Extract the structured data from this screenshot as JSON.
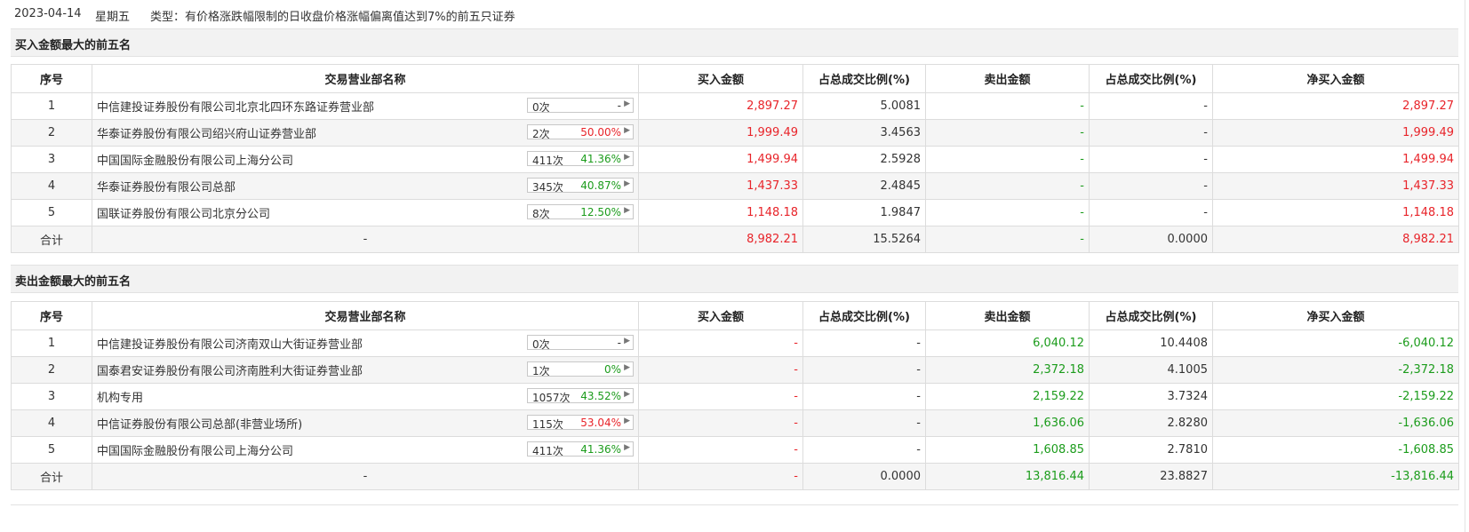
{
  "header": {
    "date": "2023-04-14",
    "weekday": "星期五",
    "type_text": "类型：有价格涨跌幅限制的日收盘价格涨幅偏离值达到7%的前五只证券"
  },
  "colors": {
    "up": "#e8242a",
    "down": "#1c9c1c"
  },
  "columns": {
    "idx": "序号",
    "name": "交易营业部名称",
    "buy": "买入金额",
    "buy_pct": "占总成交比例(%)",
    "sell": "卖出金额",
    "sell_pct": "占总成交比例(%)",
    "net": "净买入金额"
  },
  "buy_table": {
    "title": "买入金额最大的前五名",
    "rows": [
      {
        "idx": "1",
        "name": "中信建投证券股份有限公司北京北四环东路证券营业部",
        "count": "0次",
        "rate": "-",
        "rate_color": "neutral",
        "buy": "2,897.27",
        "buy_pct": "5.0081",
        "sell": "-",
        "sell_pct": "-",
        "net": "2,897.27"
      },
      {
        "idx": "2",
        "name": "华泰证券股份有限公司绍兴府山证券营业部",
        "count": "2次",
        "rate": "50.00%",
        "rate_color": "red",
        "buy": "1,999.49",
        "buy_pct": "3.4563",
        "sell": "-",
        "sell_pct": "-",
        "net": "1,999.49"
      },
      {
        "idx": "3",
        "name": "中国国际金融股份有限公司上海分公司",
        "count": "411次",
        "rate": "41.36%",
        "rate_color": "green",
        "buy": "1,499.94",
        "buy_pct": "2.5928",
        "sell": "-",
        "sell_pct": "-",
        "net": "1,499.94"
      },
      {
        "idx": "4",
        "name": "华泰证券股份有限公司总部",
        "count": "345次",
        "rate": "40.87%",
        "rate_color": "green",
        "buy": "1,437.33",
        "buy_pct": "2.4845",
        "sell": "-",
        "sell_pct": "-",
        "net": "1,437.33"
      },
      {
        "idx": "5",
        "name": "国联证券股份有限公司北京分公司",
        "count": "8次",
        "rate": "12.50%",
        "rate_color": "green",
        "buy": "1,148.18",
        "buy_pct": "1.9847",
        "sell": "-",
        "sell_pct": "-",
        "net": "1,148.18"
      }
    ],
    "total": {
      "label": "合计",
      "name": "-",
      "buy": "8,982.21",
      "buy_pct": "15.5264",
      "sell": "-",
      "sell_pct": "0.0000",
      "net": "8,982.21"
    }
  },
  "sell_table": {
    "title": "卖出金额最大的前五名",
    "rows": [
      {
        "idx": "1",
        "name": "中信建投证券股份有限公司济南双山大街证券营业部",
        "count": "0次",
        "rate": "-",
        "rate_color": "neutral",
        "buy": "-",
        "buy_pct": "-",
        "sell": "6,040.12",
        "sell_pct": "10.4408",
        "net": "-6,040.12"
      },
      {
        "idx": "2",
        "name": "国泰君安证券股份有限公司济南胜利大街证券营业部",
        "count": "1次",
        "rate": "0%",
        "rate_color": "green",
        "buy": "-",
        "buy_pct": "-",
        "sell": "2,372.18",
        "sell_pct": "4.1005",
        "net": "-2,372.18"
      },
      {
        "idx": "3",
        "name": "机构专用",
        "count": "1057次",
        "rate": "43.52%",
        "rate_color": "green",
        "buy": "-",
        "buy_pct": "-",
        "sell": "2,159.22",
        "sell_pct": "3.7324",
        "net": "-2,159.22"
      },
      {
        "idx": "4",
        "name": "中信证券股份有限公司总部(非营业场所)",
        "count": "115次",
        "rate": "53.04%",
        "rate_color": "red",
        "buy": "-",
        "buy_pct": "-",
        "sell": "1,636.06",
        "sell_pct": "2.8280",
        "net": "-1,636.06"
      },
      {
        "idx": "5",
        "name": "中国国际金融股份有限公司上海分公司",
        "count": "411次",
        "rate": "41.36%",
        "rate_color": "green",
        "buy": "-",
        "buy_pct": "-",
        "sell": "1,608.85",
        "sell_pct": "2.7810",
        "net": "-1,608.85"
      }
    ],
    "total": {
      "label": "合计",
      "name": "-",
      "buy": "-",
      "buy_pct": "0.0000",
      "sell": "13,816.44",
      "sell_pct": "23.8827",
      "net": "-13,816.44"
    }
  }
}
